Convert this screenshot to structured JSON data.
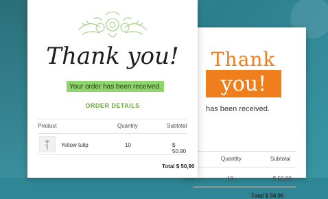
{
  "front": {
    "heading": "Thank you!",
    "received": "Your order has been received.",
    "section_title": "ORDER DETAILS",
    "columns": [
      "Product",
      "Quantity",
      "Subtotal"
    ],
    "row": {
      "product": "Yellow tulip",
      "quantity": "10",
      "subtotal": "$ 50.90"
    },
    "total": "Total $ 50,90"
  },
  "back": {
    "heading_line1": "Thank",
    "heading_line2": "you!",
    "received": "has been received.",
    "columns": [
      "Quantity",
      "Subtotal"
    ],
    "row": {
      "quantity": "10",
      "subtotal": "$ 50.90"
    },
    "total": "Total $ 50,90"
  },
  "colors": {
    "accent_green": "#8fd46d",
    "accent_orange": "#ee7f1c",
    "background": "#2f8796"
  },
  "icons": {
    "floral": "floral-ornament-icon",
    "thumbnail": "tulip-thumbnail-icon"
  }
}
